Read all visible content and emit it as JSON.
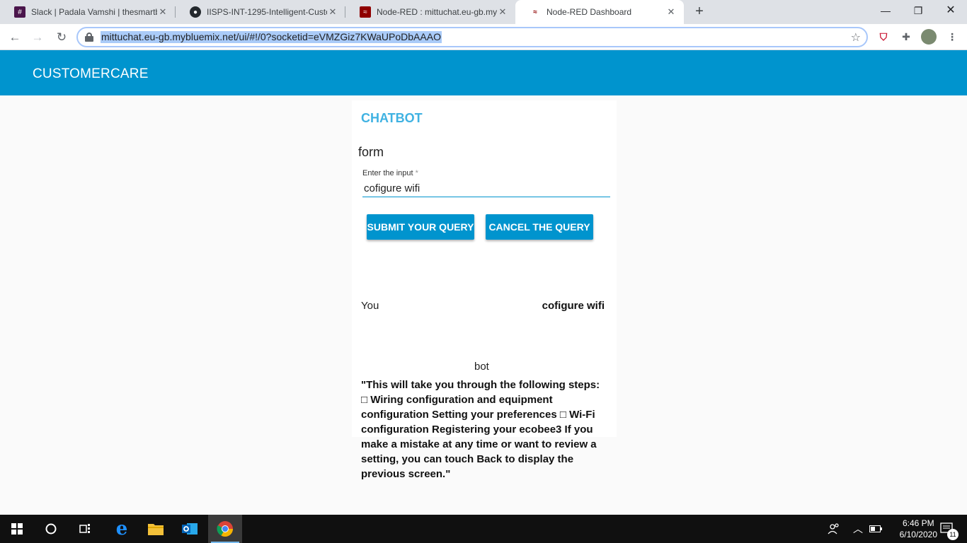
{
  "browser": {
    "tabs": [
      {
        "title": "Slack | Padala Vamshi | thesmartb",
        "icon": "slack-icon"
      },
      {
        "title": "IISPS-INT-1295-Intelligent-Custo",
        "icon": "github-icon"
      },
      {
        "title": "Node-RED : mittuchat.eu-gb.myb",
        "icon": "node-red-icon"
      },
      {
        "title": "Node-RED Dashboard",
        "icon": "node-red-icon",
        "active": true
      }
    ],
    "url": "mittuchat.eu-gb.mybluemix.net/ui/#!/0?socketid=eVMZGiz7KWaUPoDbAAAO"
  },
  "app": {
    "title": "CUSTOMERCARE",
    "header_color": "#0094ce"
  },
  "card": {
    "title": "CHATBOT",
    "form_label": "form",
    "input_label": "Enter the input",
    "input_required_mark": "*",
    "input_value": "cofigure wifi",
    "submit_label": "SUBMIT YOUR QUERY",
    "cancel_label": "CANCEL THE QUERY"
  },
  "chat": {
    "you_label": "You",
    "you_message": "cofigure wifi",
    "bot_label": "bot",
    "bot_message": "\"This will take you through the following steps: □ Wiring configuration and equipment configuration Setting your preferences □ Wi-Fi configuration Registering your ecobee3 If you make a mistake at any time or want to review a setting, you can touch Back to display the previous screen.\""
  },
  "taskbar": {
    "time": "6:46 PM",
    "date": "6/10/2020",
    "notification_count": "11"
  }
}
